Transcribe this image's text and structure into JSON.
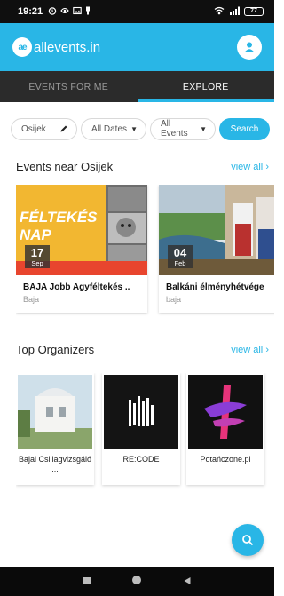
{
  "status_bar": {
    "time": "19:21",
    "battery": "77"
  },
  "header": {
    "logo_badge": "ae",
    "logo_text": "allevents.in"
  },
  "tabs": [
    {
      "label": "EVENTS FOR ME",
      "active": false
    },
    {
      "label": "EXPLORE",
      "active": true
    }
  ],
  "filters": {
    "city": "Osijek",
    "dates": "All Dates",
    "events": "All Events",
    "search_label": "Search"
  },
  "events_section": {
    "title": "Events near Osijek",
    "view_all": "view all",
    "cards": [
      {
        "title": "BAJA Jobb Agyféltekés ..",
        "location": "Baja",
        "day": "17",
        "month": "Sep",
        "image_text_1": "FÉLTEKÉS",
        "image_text_2": "NAP"
      },
      {
        "title": "Balkáni élményhétvége",
        "location": "baja",
        "day": "04",
        "month": "Feb"
      }
    ]
  },
  "organizers_section": {
    "title": "Top Organizers",
    "view_all": "view all",
    "cards": [
      {
        "name": "Bajai Csillagvizsgáló ..."
      },
      {
        "name": "RE:CODE"
      },
      {
        "name": "Potańczone.pl"
      }
    ]
  },
  "colors": {
    "accent": "#29b6e6",
    "tabs_bg": "#2b2b2b"
  }
}
